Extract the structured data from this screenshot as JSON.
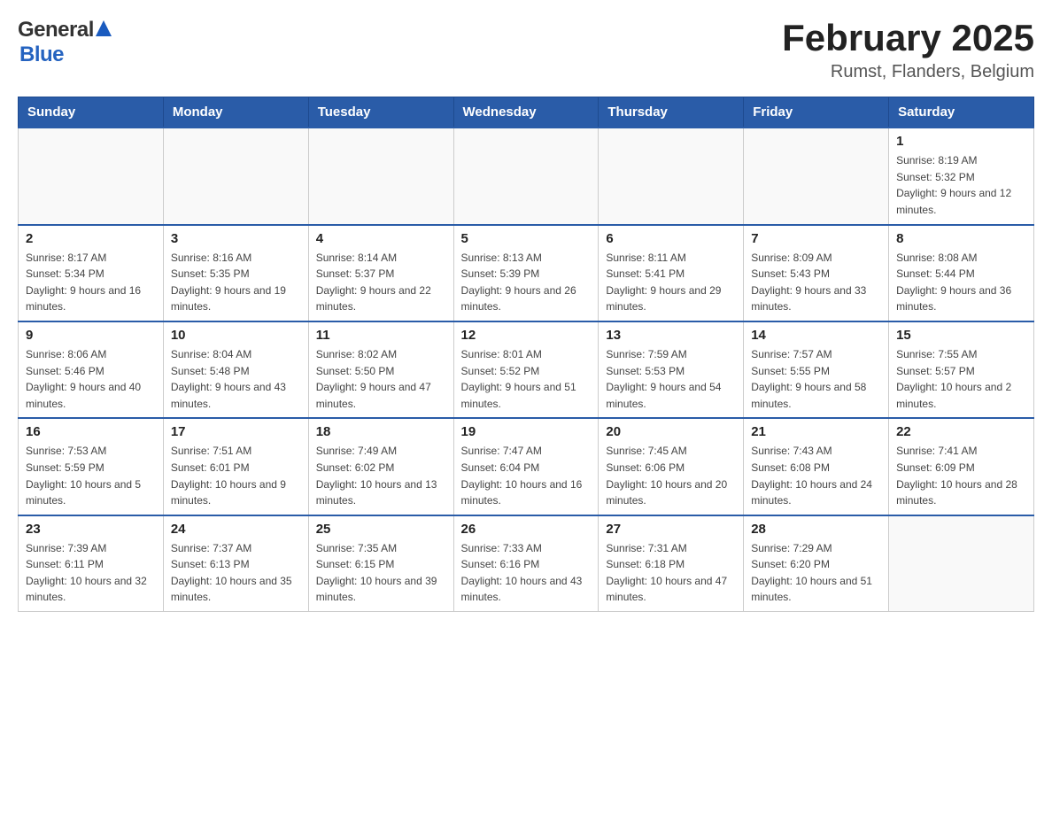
{
  "header": {
    "logo": {
      "general": "General",
      "blue": "Blue"
    },
    "title": "February 2025",
    "subtitle": "Rumst, Flanders, Belgium"
  },
  "calendar": {
    "days_of_week": [
      "Sunday",
      "Monday",
      "Tuesday",
      "Wednesday",
      "Thursday",
      "Friday",
      "Saturday"
    ],
    "weeks": [
      [
        {
          "day": "",
          "info": ""
        },
        {
          "day": "",
          "info": ""
        },
        {
          "day": "",
          "info": ""
        },
        {
          "day": "",
          "info": ""
        },
        {
          "day": "",
          "info": ""
        },
        {
          "day": "",
          "info": ""
        },
        {
          "day": "1",
          "info": "Sunrise: 8:19 AM\nSunset: 5:32 PM\nDaylight: 9 hours and 12 minutes."
        }
      ],
      [
        {
          "day": "2",
          "info": "Sunrise: 8:17 AM\nSunset: 5:34 PM\nDaylight: 9 hours and 16 minutes."
        },
        {
          "day": "3",
          "info": "Sunrise: 8:16 AM\nSunset: 5:35 PM\nDaylight: 9 hours and 19 minutes."
        },
        {
          "day": "4",
          "info": "Sunrise: 8:14 AM\nSunset: 5:37 PM\nDaylight: 9 hours and 22 minutes."
        },
        {
          "day": "5",
          "info": "Sunrise: 8:13 AM\nSunset: 5:39 PM\nDaylight: 9 hours and 26 minutes."
        },
        {
          "day": "6",
          "info": "Sunrise: 8:11 AM\nSunset: 5:41 PM\nDaylight: 9 hours and 29 minutes."
        },
        {
          "day": "7",
          "info": "Sunrise: 8:09 AM\nSunset: 5:43 PM\nDaylight: 9 hours and 33 minutes."
        },
        {
          "day": "8",
          "info": "Sunrise: 8:08 AM\nSunset: 5:44 PM\nDaylight: 9 hours and 36 minutes."
        }
      ],
      [
        {
          "day": "9",
          "info": "Sunrise: 8:06 AM\nSunset: 5:46 PM\nDaylight: 9 hours and 40 minutes."
        },
        {
          "day": "10",
          "info": "Sunrise: 8:04 AM\nSunset: 5:48 PM\nDaylight: 9 hours and 43 minutes."
        },
        {
          "day": "11",
          "info": "Sunrise: 8:02 AM\nSunset: 5:50 PM\nDaylight: 9 hours and 47 minutes."
        },
        {
          "day": "12",
          "info": "Sunrise: 8:01 AM\nSunset: 5:52 PM\nDaylight: 9 hours and 51 minutes."
        },
        {
          "day": "13",
          "info": "Sunrise: 7:59 AM\nSunset: 5:53 PM\nDaylight: 9 hours and 54 minutes."
        },
        {
          "day": "14",
          "info": "Sunrise: 7:57 AM\nSunset: 5:55 PM\nDaylight: 9 hours and 58 minutes."
        },
        {
          "day": "15",
          "info": "Sunrise: 7:55 AM\nSunset: 5:57 PM\nDaylight: 10 hours and 2 minutes."
        }
      ],
      [
        {
          "day": "16",
          "info": "Sunrise: 7:53 AM\nSunset: 5:59 PM\nDaylight: 10 hours and 5 minutes."
        },
        {
          "day": "17",
          "info": "Sunrise: 7:51 AM\nSunset: 6:01 PM\nDaylight: 10 hours and 9 minutes."
        },
        {
          "day": "18",
          "info": "Sunrise: 7:49 AM\nSunset: 6:02 PM\nDaylight: 10 hours and 13 minutes."
        },
        {
          "day": "19",
          "info": "Sunrise: 7:47 AM\nSunset: 6:04 PM\nDaylight: 10 hours and 16 minutes."
        },
        {
          "day": "20",
          "info": "Sunrise: 7:45 AM\nSunset: 6:06 PM\nDaylight: 10 hours and 20 minutes."
        },
        {
          "day": "21",
          "info": "Sunrise: 7:43 AM\nSunset: 6:08 PM\nDaylight: 10 hours and 24 minutes."
        },
        {
          "day": "22",
          "info": "Sunrise: 7:41 AM\nSunset: 6:09 PM\nDaylight: 10 hours and 28 minutes."
        }
      ],
      [
        {
          "day": "23",
          "info": "Sunrise: 7:39 AM\nSunset: 6:11 PM\nDaylight: 10 hours and 32 minutes."
        },
        {
          "day": "24",
          "info": "Sunrise: 7:37 AM\nSunset: 6:13 PM\nDaylight: 10 hours and 35 minutes."
        },
        {
          "day": "25",
          "info": "Sunrise: 7:35 AM\nSunset: 6:15 PM\nDaylight: 10 hours and 39 minutes."
        },
        {
          "day": "26",
          "info": "Sunrise: 7:33 AM\nSunset: 6:16 PM\nDaylight: 10 hours and 43 minutes."
        },
        {
          "day": "27",
          "info": "Sunrise: 7:31 AM\nSunset: 6:18 PM\nDaylight: 10 hours and 47 minutes."
        },
        {
          "day": "28",
          "info": "Sunrise: 7:29 AM\nSunset: 6:20 PM\nDaylight: 10 hours and 51 minutes."
        },
        {
          "day": "",
          "info": ""
        }
      ]
    ]
  }
}
